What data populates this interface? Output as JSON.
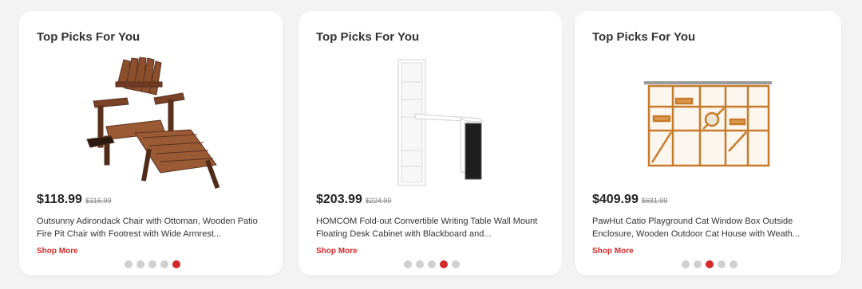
{
  "cards": [
    {
      "title": "Top Picks For You",
      "price": "$118.99",
      "old_price": "$316.99",
      "description": "Outsunny Adirondack Chair with Ottoman, Wooden Patio Fire Pit Chair with Footrest with Wide Armrest...",
      "cta": "Shop More",
      "image": "adirondack-chair-image",
      "carousel": {
        "total": 5,
        "active_index": 4
      }
    },
    {
      "title": "Top Picks For You",
      "price": "$203.99",
      "old_price": "$224.99",
      "description": "HOMCOM Fold-out Convertible Writing Table Wall Mount Floating Desk Cabinet with Blackboard and...",
      "cta": "Shop More",
      "image": "wall-desk-image",
      "carousel": {
        "total": 5,
        "active_index": 3
      }
    },
    {
      "title": "Top Picks For You",
      "price": "$409.99",
      "old_price": "$681.99",
      "description": "PawHut Catio Playground Cat Window Box Outside Enclosure, Wooden Outdoor Cat House with Weath...",
      "cta": "Shop More",
      "image": "catio-enclosure-image",
      "carousel": {
        "total": 5,
        "active_index": 2
      }
    }
  ],
  "colors": {
    "accent": "#d3282a",
    "dot_inactive": "#d0d0d0",
    "card_bg": "#ffffff",
    "page_bg": "#f3f3f3"
  }
}
